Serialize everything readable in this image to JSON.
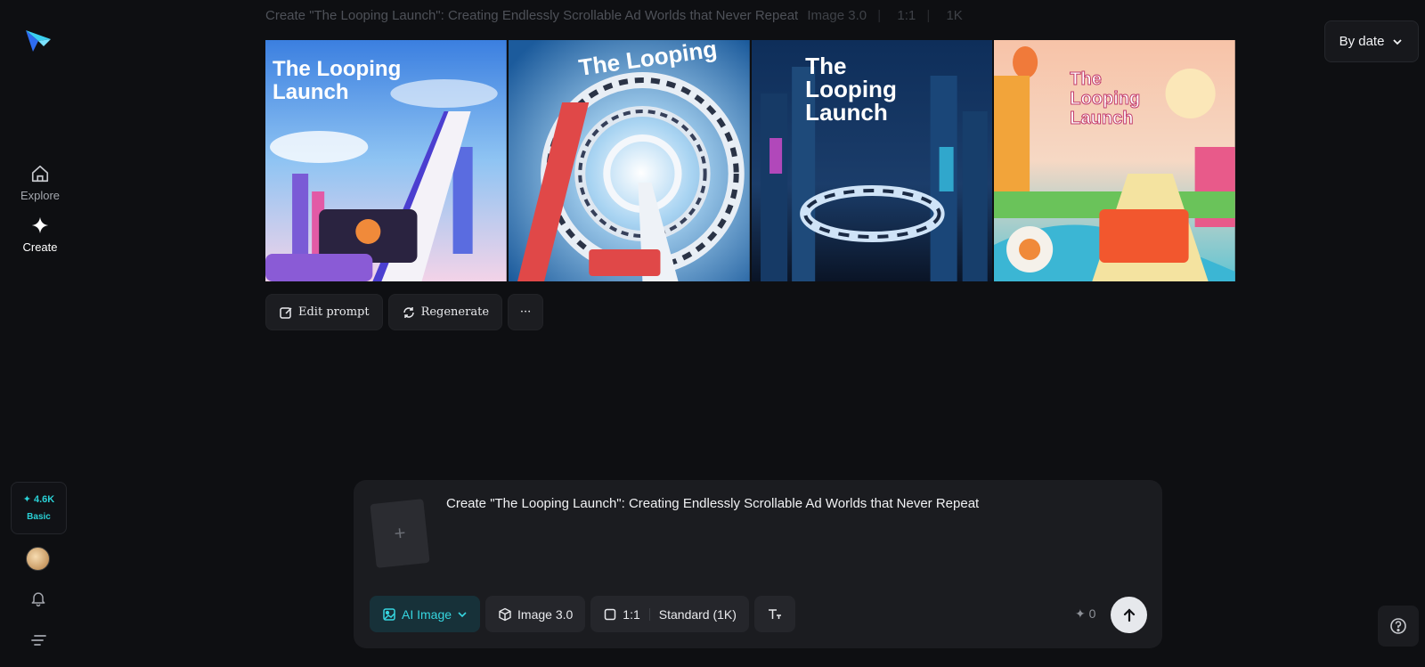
{
  "colors": {
    "background": "#0e0f12",
    "accent": "#2ad1d6",
    "panel": "#1b1c20"
  },
  "sidebar": {
    "logo_icon": "paper-plane-logo-icon",
    "nav": [
      {
        "label": "Explore",
        "icon": "home-icon"
      },
      {
        "label": "Create",
        "icon": "sparkle-icon"
      }
    ],
    "credits": {
      "amount": "✦ 4.6K",
      "plan": "Basic"
    },
    "bell_icon": "bell-icon",
    "menu_icon": "menu-lines-icon"
  },
  "generation": {
    "prompt": "Create \"The Looping Launch\": Creating Endlessly Scrollable Ad Worlds that Never Repeat",
    "model": "Image 3.0",
    "ratio": "1:1",
    "resolution": "1K",
    "images": [
      {
        "alt": "The Looping Launch poster with ramp and cityscape"
      },
      {
        "alt": "The Looping spiral tunnel of ads"
      },
      {
        "alt": "The Looping Launch neon city with ring of screens"
      },
      {
        "alt": "Create The Looping Launch colorful resort track"
      }
    ],
    "actions": {
      "edit": "Edit prompt",
      "regenerate": "Regenerate",
      "more": "···"
    }
  },
  "sort": {
    "label": "By date"
  },
  "composer": {
    "prompt": "Create \"The Looping Launch\": Creating Endlessly Scrollable Ad Worlds that Never Repeat",
    "upload_symbol": "+",
    "mode": "AI Image",
    "model": "Image 3.0",
    "ratio": "1:1",
    "quality": "Standard (1K)",
    "cost": "✦ 0"
  }
}
